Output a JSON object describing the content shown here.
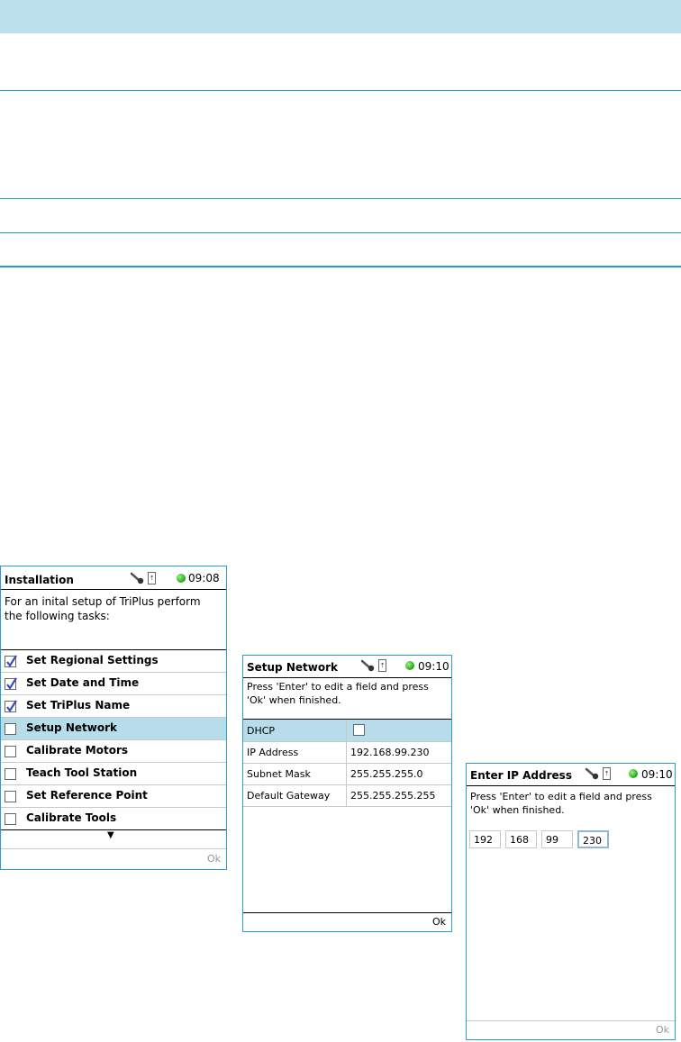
{
  "screens": {
    "installation": {
      "title": "Installation",
      "time": "09:08",
      "intro_line1": "For an inital setup of TriPlus perform",
      "intro_line2": "the following tasks:",
      "tasks": [
        {
          "label": "Set Regional Settings",
          "checked": true
        },
        {
          "label": "Set Date and Time",
          "checked": true
        },
        {
          "label": "Set TriPlus Name",
          "checked": true
        },
        {
          "label": "Setup Network",
          "checked": false,
          "selected": true
        },
        {
          "label": "Calibrate Motors",
          "checked": false
        },
        {
          "label": "Teach Tool Station",
          "checked": false
        },
        {
          "label": "Set Reference Point",
          "checked": false
        },
        {
          "label": "Calibrate Tools",
          "checked": false
        }
      ],
      "scroll_indicator": "▼",
      "ok_label": "Ok"
    },
    "setup_network": {
      "title": "Setup Network",
      "time": "09:10",
      "intro_line1": "Press 'Enter' to edit a field and press",
      "intro_line2": "'Ok' when finished.",
      "rows": [
        {
          "key": "DHCP",
          "value": ""
        },
        {
          "key": "IP Address",
          "value": "192.168.99.230"
        },
        {
          "key": "Subnet Mask",
          "value": "255.255.255.0"
        },
        {
          "key": "Default Gateway",
          "value": "255.255.255.255"
        }
      ],
      "ok_label": "Ok"
    },
    "enter_ip": {
      "title": "Enter IP Address",
      "time": "09:10",
      "intro_line1": "Press 'Enter' to edit a field and press",
      "intro_line2": "'Ok' when finished.",
      "octets": [
        "192",
        "168",
        "99",
        "230"
      ],
      "ok_label": "Ok"
    }
  },
  "colors": {
    "accent": "#2b9bd1",
    "header_fill": "#bde0ed",
    "selection": "#b7dcea",
    "status_green": "#21a51a"
  }
}
